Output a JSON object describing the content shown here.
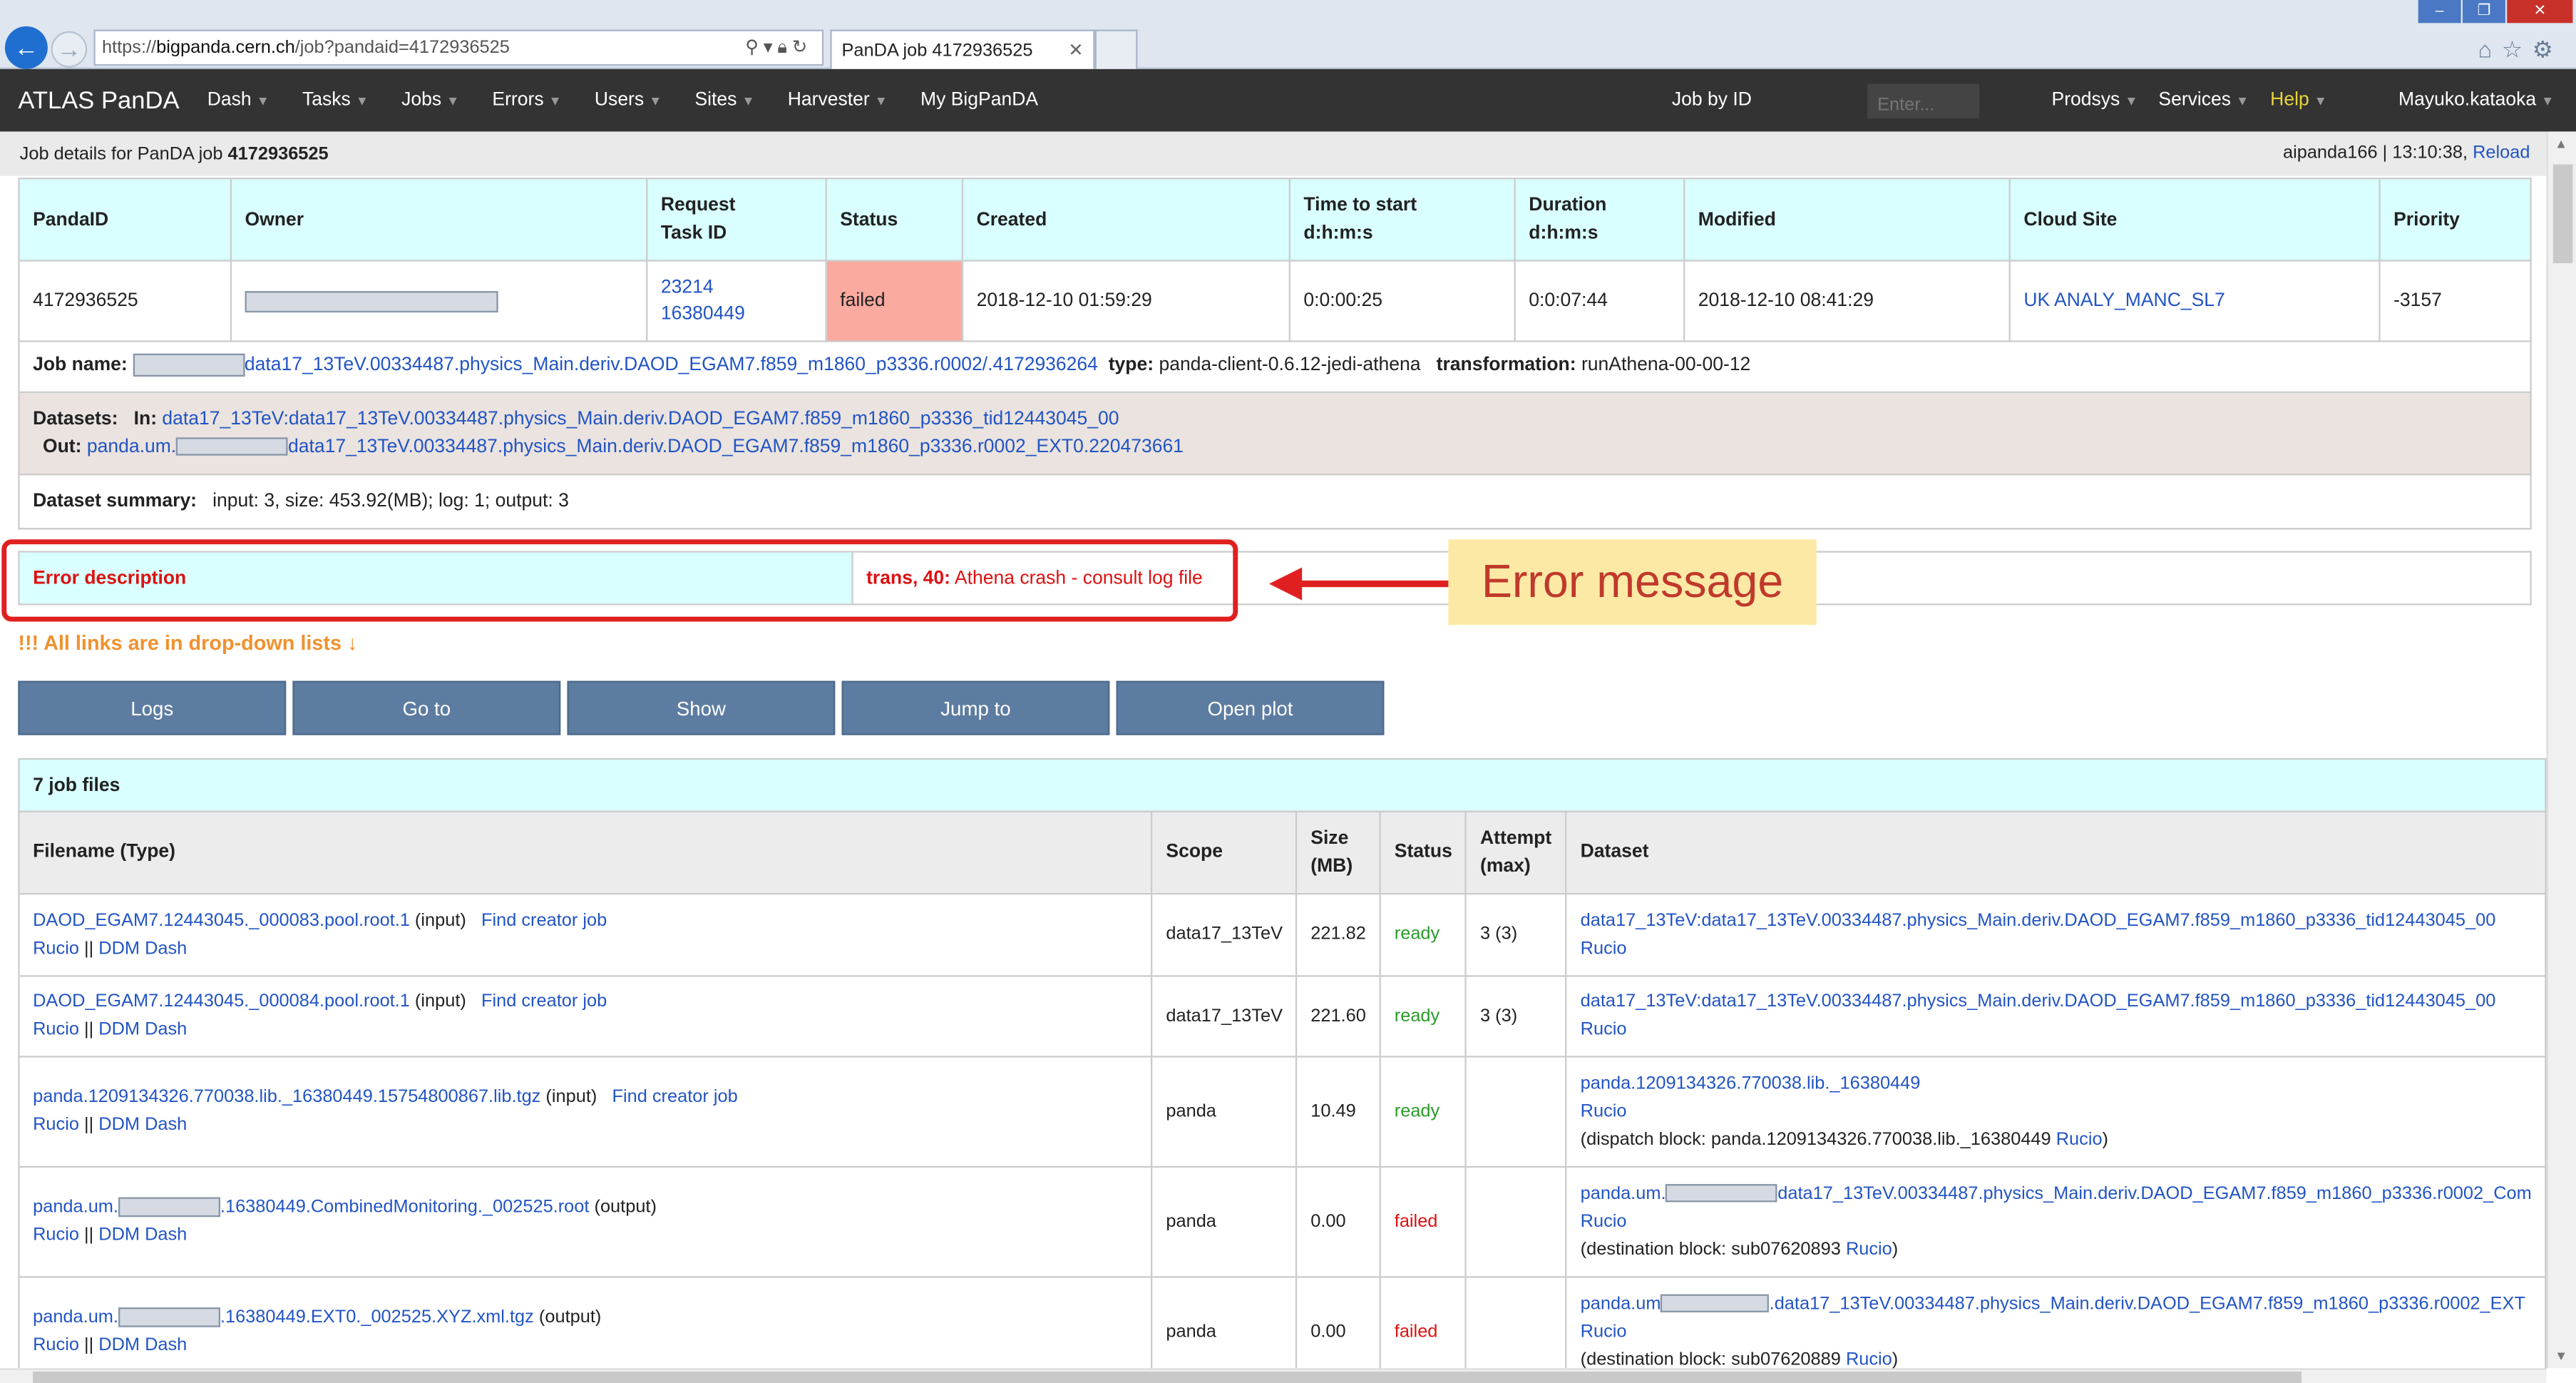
{
  "browser": {
    "url_prefix": "https://",
    "url_host": "bigpanda.cern.ch",
    "url_path": "/job?pandaid=4172936525",
    "tab_title": "PanDA job 4172936525"
  },
  "navbar": {
    "brand": "ATLAS PanDA",
    "items": [
      "Dash",
      "Tasks",
      "Jobs",
      "Errors",
      "Users",
      "Sites",
      "Harvester"
    ],
    "mybigpanda": "My BigPanDA",
    "job_by_id": "Job by ID",
    "search_placeholder": "Enter...",
    "prodsys": "Prodsys",
    "services": "Services",
    "help": "Help",
    "user": "Mayuko.kataoka"
  },
  "subheader": {
    "label": "Job details for PanDA job",
    "job_id": "4172936525",
    "server_time": "aipanda166 | 13:10:38,",
    "reload": "Reload"
  },
  "job_table": {
    "headers": [
      "PandaID",
      "Owner",
      "Request\nTask ID",
      "Status",
      "Created",
      "Time to start\nd:h:m:s",
      "Duration\nd:h:m:s",
      "Modified",
      "Cloud Site",
      "Priority"
    ],
    "pandaid": "4172936525",
    "request_id": "23214",
    "task_id": "16380449",
    "status": "failed",
    "created": "2018-12-10 01:59:29",
    "time_to_start": "0:0:00:25",
    "duration": "0:0:07:44",
    "modified": "2018-12-10 08:41:29",
    "cloud_site": "UK ANALY_MANC_SL7",
    "priority": "-3157"
  },
  "job_name": {
    "label": "Job name:",
    "value": "data17_13TeV.00334487.physics_Main.deriv.DAOD_EGAM7.f859_m1860_p3336.r0002/.4172936264",
    "type_label": "type:",
    "type_value": "panda-client-0.6.12-jedi-athena",
    "transformation_label": "transformation:",
    "transformation_value": "runAthena-00-00-12"
  },
  "datasets": {
    "label": "Datasets:",
    "in_label": "In:",
    "in_value": "data17_13TeV:data17_13TeV.00334487.physics_Main.deriv.DAOD_EGAM7.f859_m1860_p3336_tid12443045_00",
    "out_label": "Out:",
    "out_prefix": "panda.um.",
    "out_value": "data17_13TeV.00334487.physics_Main.deriv.DAOD_EGAM7.f859_m1860_p3336.r0002_EXT0.220473661"
  },
  "dataset_summary": {
    "label": "Dataset summary:",
    "value": "input: 3, size: 453.92(MB); log: 1; output: 3"
  },
  "error": {
    "label": "Error description",
    "code": "trans, 40:",
    "message": "Athena crash - consult log file",
    "callout": "Error message"
  },
  "links_notice": "!!! All links are in drop-down lists ↓",
  "buttons": [
    "Logs",
    "Go to",
    "Show",
    "Jump to",
    "Open plot"
  ],
  "files": {
    "title": "7 job files",
    "headers": [
      "Filename (Type)",
      "Scope",
      "Size\n(MB)",
      "Status",
      "Attempt\n(max)",
      "Dataset"
    ],
    "rucio": "Rucio",
    "ddm": "DDM Dash",
    "sep": "||",
    "find_creator": "Find creator job",
    "rows": [
      {
        "name": "DAOD_EGAM7.12443045._000083.pool.root.1",
        "type": "(input)",
        "scope": "data17_13TeV",
        "size": "221.82",
        "status": "ready",
        "attempt": "3 (3)",
        "dataset": "data17_13TeV:data17_13TeV.00334487.physics_Main.deriv.DAOD_EGAM7.f859_m1860_p3336_tid12443045_00"
      },
      {
        "name": "DAOD_EGAM7.12443045._000084.pool.root.1",
        "type": "(input)",
        "scope": "data17_13TeV",
        "size": "221.60",
        "status": "ready",
        "attempt": "3 (3)",
        "dataset": "data17_13TeV:data17_13TeV.00334487.physics_Main.deriv.DAOD_EGAM7.f859_m1860_p3336_tid12443045_00"
      },
      {
        "name": "panda.1209134326.770038.lib._16380449.15754800867.lib.tgz",
        "type": "(input)",
        "scope": "panda",
        "size": "10.49",
        "status": "ready",
        "attempt": "",
        "dataset": "panda.1209134326.770038.lib._16380449",
        "block_label": "(dispatch block: panda.1209134326.770038.lib._16380449",
        "block_end": ")"
      },
      {
        "name_prefix": "panda.um.",
        "name": ".16380449.CombinedMonitoring._002525.root",
        "type": "(output)",
        "scope": "panda",
        "size": "0.00",
        "status": "failed",
        "attempt": "",
        "dataset_prefix": "panda.um.",
        "dataset": "data17_13TeV.00334487.physics_Main.deriv.DAOD_EGAM7.f859_m1860_p3336.r0002_Com",
        "block_label": "(destination block: sub07620893",
        "block_end": ")"
      },
      {
        "name_prefix": "panda.um.",
        "name": ".16380449.EXT0._002525.XYZ.xml.tgz",
        "type": "(output)",
        "scope": "panda",
        "size": "0.00",
        "status": "failed",
        "attempt": "",
        "dataset_prefix": "panda.um",
        "dataset": ".data17_13TeV.00334487.physics_Main.deriv.DAOD_EGAM7.f859_m1860_p3336.r0002_EXT",
        "block_label": "(destination block: sub07620889",
        "block_end": ")"
      }
    ]
  },
  "colors": {
    "navbar_bg": "#333333",
    "header_cyan": "#d9ffff",
    "failed_bg": "#fbaaa0",
    "link": "#2254c4",
    "ready": "#2a9a2a",
    "error_red": "#dd1111",
    "button": "#5d7ca1",
    "callout_bg": "#fde9a6"
  },
  "icons": [
    "back-icon",
    "forward-icon",
    "search-icon",
    "lock-icon",
    "refresh-icon",
    "home-icon",
    "star-icon",
    "gear-icon"
  ]
}
